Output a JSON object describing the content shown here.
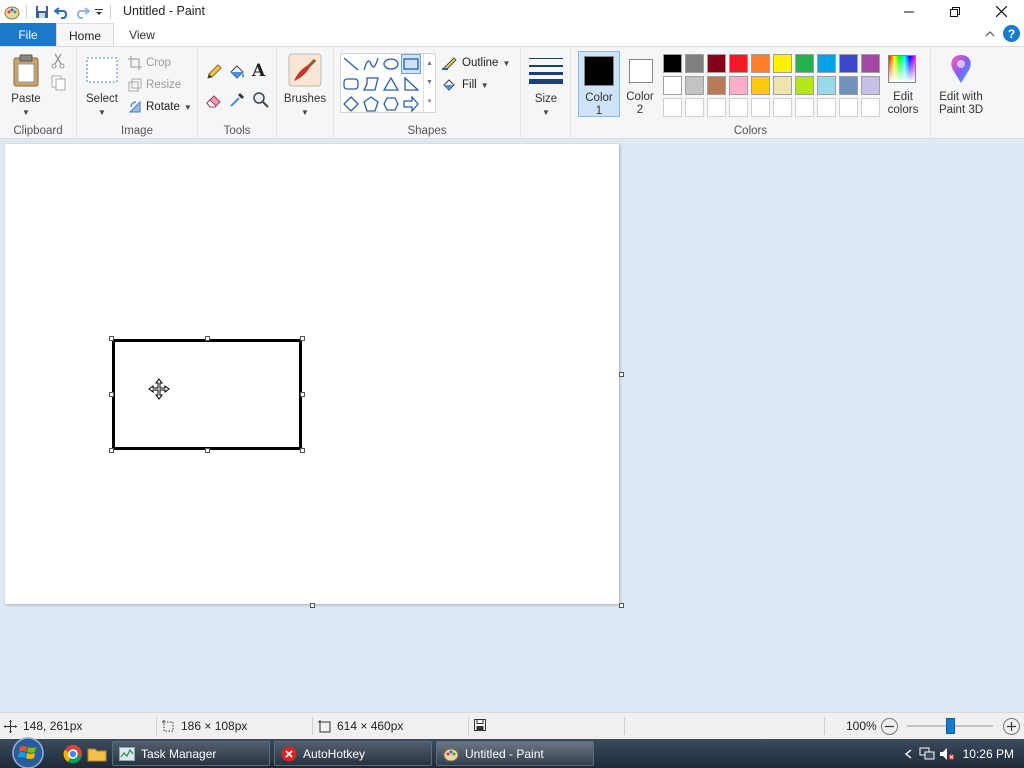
{
  "window": {
    "title": "Untitled - Paint"
  },
  "tabs": {
    "file": "File",
    "home": "Home",
    "view": "View"
  },
  "ribbon": {
    "clipboard": {
      "paste": "Paste",
      "label": "Clipboard"
    },
    "image": {
      "select": "Select",
      "crop": "Crop",
      "resize": "Resize",
      "rotate": "Rotate",
      "label": "Image"
    },
    "tools": {
      "label": "Tools"
    },
    "brushes": {
      "label": "Brushes"
    },
    "shapes": {
      "outline": "Outline",
      "fill": "Fill",
      "label": "Shapes"
    },
    "size": {
      "label": "Size"
    },
    "color1": {
      "label": "Color",
      "num": "1",
      "value": "#000000"
    },
    "color2": {
      "label": "Color",
      "num": "2",
      "value": "#ffffff"
    },
    "colors": {
      "label": "Colors",
      "row1": [
        "#000000",
        "#7f7f7f",
        "#880015",
        "#ed1c24",
        "#ff7f27",
        "#fff200",
        "#22b14c",
        "#00a2e8",
        "#3f48cc",
        "#a349a4"
      ],
      "row2": [
        "#ffffff",
        "#c3c3c3",
        "#b97a57",
        "#ffaec9",
        "#ffc90e",
        "#efe4b0",
        "#b5e61d",
        "#99d9ea",
        "#7092be",
        "#c8bfe7"
      ]
    },
    "edit_colors": {
      "line1": "Edit",
      "line2": "colors"
    },
    "paint3d": {
      "line1": "Edit with",
      "line2": "Paint 3D"
    }
  },
  "status": {
    "cursor_pos": "148, 261px",
    "selection_size": "186 × 108px",
    "canvas_size": "614 × 460px",
    "zoom": "100%",
    "zoom_fraction": 0.5
  },
  "taskbar": {
    "tasks": [
      {
        "label": "Task Manager"
      },
      {
        "label": "AutoHotkey"
      },
      {
        "label": "Untitled - Paint"
      }
    ],
    "clock": "10:26 PM"
  }
}
